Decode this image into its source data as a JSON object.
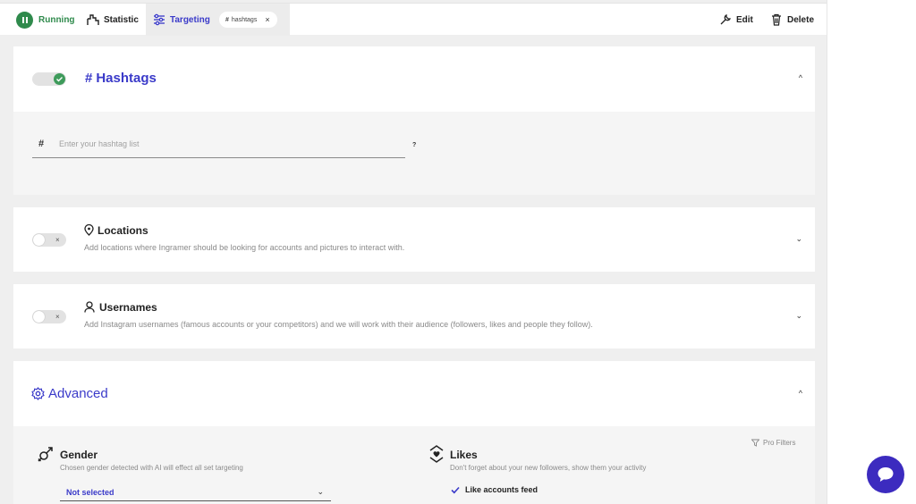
{
  "toolbar": {
    "running_label": "Running",
    "statistic_label": "Statistic",
    "targeting_label": "Targeting",
    "chip_label": "hashtags",
    "chip_close": "×",
    "edit_label": "Edit",
    "delete_label": "Delete"
  },
  "hashtags": {
    "title": "Hashtags",
    "enabled": true,
    "input_placeholder": "Enter your hashtag list",
    "help": "?",
    "chevron": "^"
  },
  "locations": {
    "title": "Locations",
    "enabled": false,
    "desc": "Add locations where Ingramer should be looking for accounts and pictures to interact with.",
    "chevron": "⌄"
  },
  "usernames": {
    "title": "Usernames",
    "enabled": false,
    "desc": "Add Instagram usernames (famous accounts or your competitors) and we will work with their audience (followers, likes and people they follow).",
    "chevron": "⌄"
  },
  "advanced": {
    "title": "Advanced",
    "chevron": "^",
    "pro_filters": "Pro Filters",
    "gender": {
      "title": "Gender",
      "desc": "Chosen gender detected with AI will effect all set targeting",
      "select_value": "Not selected"
    },
    "likes": {
      "title": "Likes",
      "desc": "Don't forget about your new followers, show them your activity",
      "checkbox_label": "Like accounts feed",
      "checked": true
    }
  },
  "colors": {
    "accent": "#3a3ac9",
    "running_green": "#2f8a4c",
    "chat_bg": "#3c2bbf"
  }
}
